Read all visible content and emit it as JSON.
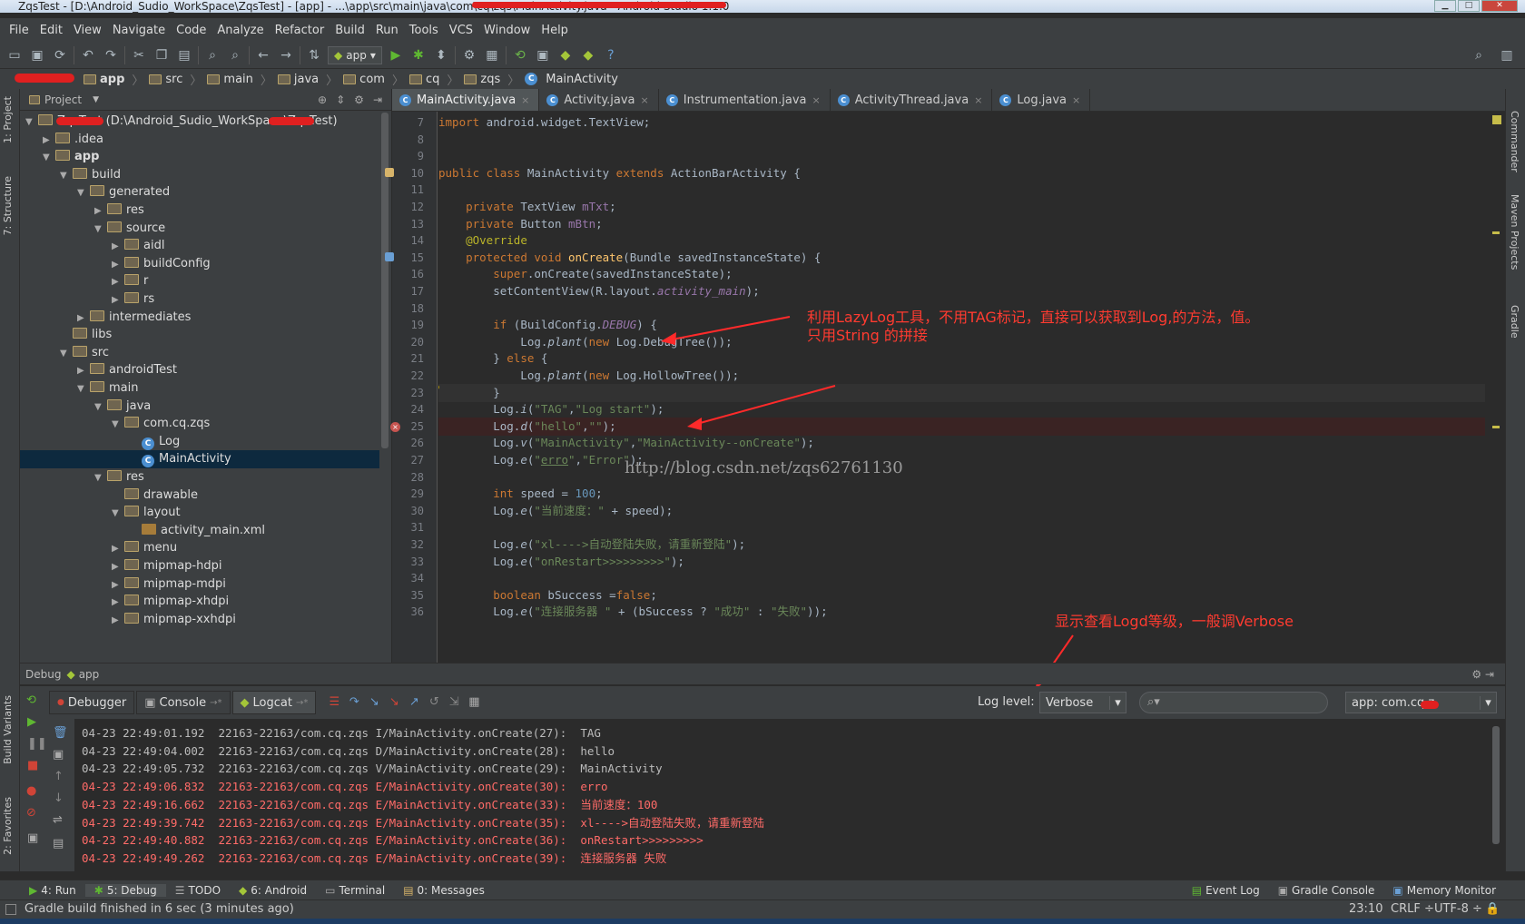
{
  "window": {
    "title": "ZqsTest - [D:\\Android_Sudio_WorkSpace\\ZqsTest] - [app] - ...\\app\\src\\main\\java\\com\\cq\\zqs\\MainActivity.java - Android Studio 1.1.0"
  },
  "menu": [
    "File",
    "Edit",
    "View",
    "Navigate",
    "Code",
    "Analyze",
    "Refactor",
    "Build",
    "Run",
    "Tools",
    "VCS",
    "Window",
    "Help"
  ],
  "toolbar": {
    "run_config": "app"
  },
  "breadcrumbs": [
    "app",
    "src",
    "main",
    "java",
    "com",
    "cq",
    "zqs",
    "MainActivity"
  ],
  "project_panel": {
    "title": "Project",
    "tree": [
      {
        "label": "ZqsTest (D:\\Android_Sudio_WorkSpace\\ZqsTest)",
        "depth": 0,
        "type": "root",
        "open": true
      },
      {
        "label": ".idea",
        "depth": 1,
        "type": "folder",
        "open": false
      },
      {
        "label": "app",
        "depth": 1,
        "type": "folder",
        "open": true,
        "bold": true
      },
      {
        "label": "build",
        "depth": 2,
        "type": "folder",
        "open": true
      },
      {
        "label": "generated",
        "depth": 3,
        "type": "folder",
        "open": true
      },
      {
        "label": "res",
        "depth": 4,
        "type": "folder",
        "open": false
      },
      {
        "label": "source",
        "depth": 4,
        "type": "folder",
        "open": true
      },
      {
        "label": "aidl",
        "depth": 5,
        "type": "folder",
        "open": false
      },
      {
        "label": "buildConfig",
        "depth": 5,
        "type": "folder",
        "open": false
      },
      {
        "label": "r",
        "depth": 5,
        "type": "folder",
        "open": false
      },
      {
        "label": "rs",
        "depth": 5,
        "type": "folder",
        "open": false
      },
      {
        "label": "intermediates",
        "depth": 3,
        "type": "folder",
        "open": false
      },
      {
        "label": "libs",
        "depth": 2,
        "type": "folder",
        "leaf": true
      },
      {
        "label": "src",
        "depth": 2,
        "type": "folder",
        "open": true
      },
      {
        "label": "androidTest",
        "depth": 3,
        "type": "folder",
        "open": false
      },
      {
        "label": "main",
        "depth": 3,
        "type": "folder",
        "open": true
      },
      {
        "label": "java",
        "depth": 4,
        "type": "folder",
        "open": true
      },
      {
        "label": "com.cq.zqs",
        "depth": 5,
        "type": "folder",
        "open": true
      },
      {
        "label": "Log",
        "depth": 6,
        "type": "class",
        "leaf": true
      },
      {
        "label": "MainActivity",
        "depth": 6,
        "type": "class",
        "leaf": true,
        "selected": true
      },
      {
        "label": "res",
        "depth": 4,
        "type": "folder",
        "open": true
      },
      {
        "label": "drawable",
        "depth": 5,
        "type": "folder",
        "leaf": true
      },
      {
        "label": "layout",
        "depth": 5,
        "type": "folder",
        "open": true
      },
      {
        "label": "activity_main.xml",
        "depth": 6,
        "type": "xml",
        "leaf": true
      },
      {
        "label": "menu",
        "depth": 5,
        "type": "folder",
        "open": false
      },
      {
        "label": "mipmap-hdpi",
        "depth": 5,
        "type": "folder",
        "open": false
      },
      {
        "label": "mipmap-mdpi",
        "depth": 5,
        "type": "folder",
        "open": false
      },
      {
        "label": "mipmap-xhdpi",
        "depth": 5,
        "type": "folder",
        "open": false
      },
      {
        "label": "mipmap-xxhdpi",
        "depth": 5,
        "type": "folder",
        "open": false
      }
    ]
  },
  "editor_tabs": [
    {
      "label": "MainActivity.java",
      "active": true
    },
    {
      "label": "Activity.java",
      "active": false
    },
    {
      "label": "Instrumentation.java",
      "active": false
    },
    {
      "label": "ActivityThread.java",
      "active": false
    },
    {
      "label": "Log.java",
      "active": false
    }
  ],
  "code_lines": [
    {
      "n": "7",
      "html": "<span class='kw'>import</span> android.widget.TextView;"
    },
    {
      "n": "8",
      "html": ""
    },
    {
      "n": "9",
      "html": ""
    },
    {
      "n": "10",
      "html": "<span class='kw'>public class</span> MainActivity <span class='kw'>extends</span> ActionBarActivity {"
    },
    {
      "n": "11",
      "html": ""
    },
    {
      "n": "12",
      "html": "    <span class='kw'>private</span> TextView <span class='fld'>mTxt</span>;"
    },
    {
      "n": "13",
      "html": "    <span class='kw'>private</span> Button <span class='fld'>mBtn</span>;"
    },
    {
      "n": "14",
      "html": "    <span class='ann'>@Override</span>"
    },
    {
      "n": "15",
      "html": "    <span class='kw'>protected void</span> <span class='mth'>onCreate</span>(Bundle savedInstanceState) {"
    },
    {
      "n": "16",
      "html": "        <span class='kw'>super</span>.onCreate(savedInstanceState);"
    },
    {
      "n": "17",
      "html": "        setContentView(R.layout.<span class='fld it'>activity_main</span>);"
    },
    {
      "n": "18",
      "html": ""
    },
    {
      "n": "19",
      "html": "        <span class='kw'>if</span> (BuildConfig.<span class='fld it'>DEBUG</span>) {"
    },
    {
      "n": "20",
      "html": "            Log.<span class='it'>plant</span>(<span class='kw'>new</span> Log.DebugTree());"
    },
    {
      "n": "21",
      "html": "        } <span class='kw'>else</span> {"
    },
    {
      "n": "22",
      "html": "            Log.<span class='it'>plant</span>(<span class='kw'>new</span> Log.HollowTree());"
    },
    {
      "n": "23",
      "html": "        }",
      "current": true
    },
    {
      "n": "24",
      "html": "        Log.<span class='it'>i</span>(<span class='str'>\"TAG\"</span>,<span class='str'>\"Log start\"</span>);"
    },
    {
      "n": "25",
      "html": "        Log.<span class='it'>d</span>(<span class='str'>\"hello\"</span>,<span class='str'>\"\"</span>);",
      "breakpoint": true
    },
    {
      "n": "26",
      "html": "        Log.<span class='it'>v</span>(<span class='str'>\"MainActivity\"</span>,<span class='str'>\"MainActivity--onCreate\"</span>);"
    },
    {
      "n": "27",
      "html": "        Log.<span class='it'>e</span>(<span class='str'>\"<span class='und'>erro</span>\"</span>,<span class='str'>\"Error\"</span>);"
    },
    {
      "n": "28",
      "html": ""
    },
    {
      "n": "29",
      "html": "        <span class='kw'>int</span> speed = <span class='num'>100</span>;"
    },
    {
      "n": "30",
      "html": "        Log.<span class='it'>e</span>(<span class='str'>\"当前速度：\"</span> + speed);"
    },
    {
      "n": "31",
      "html": ""
    },
    {
      "n": "32",
      "html": "        Log.<span class='it'>e</span>(<span class='str'>\"xl----&gt;自动登陆失败，请重新登陆\"</span>);"
    },
    {
      "n": "33",
      "html": "        Log.<span class='it'>e</span>(<span class='str'>\"onRestart&gt;&gt;&gt;&gt;&gt;&gt;&gt;&gt;&gt;\"</span>);"
    },
    {
      "n": "34",
      "html": ""
    },
    {
      "n": "35",
      "html": "        <span class='kw'>boolean</span> bSuccess =<span class='kw'>false</span>;"
    },
    {
      "n": "36",
      "html": "        Log.<span class='it'>e</span>(<span class='str'>\"连接服务器 \"</span> + (bSuccess ? <span class='str'>\"成功\"</span> : <span class='str'>\"失败\"</span>));"
    }
  ],
  "annotations": {
    "lazylog": "利用LazyLog工具，不用TAG标记，直接可以获取到Log,的方法，值。",
    "string_concat": "只用String 的拼接",
    "log_level": "显示查看Logd等级，一般调Verbose"
  },
  "watermark": "http://blog.csdn.net/zqs62761130",
  "debug_panel": {
    "title": "Debug",
    "config": "app",
    "tabs": [
      "Debugger",
      "Console",
      "Logcat"
    ],
    "log_level_label": "Log level:",
    "log_level_value": "Verbose",
    "search_placeholder": "",
    "process_filter": "app: com.cq.z"
  },
  "logcat": [
    {
      "text": "04-23 22:49:01.192  22163-22163/com.cq.zqs I/MainActivity.onCreate(27):  TAG",
      "level": "I"
    },
    {
      "text": "04-23 22:49:04.002  22163-22163/com.cq.zqs D/MainActivity.onCreate(28):  hello",
      "level": "D"
    },
    {
      "text": "04-23 22:49:05.732  22163-22163/com.cq.zqs V/MainActivity.onCreate(29):  MainActivity",
      "level": "V"
    },
    {
      "text": "04-23 22:49:06.832  22163-22163/com.cq.zqs E/MainActivity.onCreate(30):  erro",
      "level": "E"
    },
    {
      "text": "04-23 22:49:16.662  22163-22163/com.cq.zqs E/MainActivity.onCreate(33):  当前速度：100",
      "level": "E"
    },
    {
      "text": "04-23 22:49:39.742  22163-22163/com.cq.zqs E/MainActivity.onCreate(35):  xl---->自动登陆失败，请重新登陆",
      "level": "E"
    },
    {
      "text": "04-23 22:49:40.882  22163-22163/com.cq.zqs E/MainActivity.onCreate(36):  onRestart>>>>>>>>>",
      "level": "E"
    },
    {
      "text": "04-23 22:49:49.262  22163-22163/com.cq.zqs E/MainActivity.onCreate(39):  连接服务器 失败",
      "level": "E"
    }
  ],
  "bottom_tabs": {
    "run": "4: Run",
    "debug": "5: Debug",
    "todo": "TODO",
    "android": "6: Android",
    "terminal": "Terminal",
    "messages": "0: Messages",
    "event_log": "Event Log",
    "gradle_console": "Gradle Console",
    "memory_monitor": "Memory Monitor"
  },
  "side_tabs": {
    "project": "1: Project",
    "structure": "7: Structure",
    "build_variants": "Build Variants",
    "favorites": "2: Favorites",
    "commander": "Commander",
    "maven": "Maven Projects",
    "gradle": "Gradle"
  },
  "status": {
    "message": "Gradle build finished in 6 sec (3 minutes ago)",
    "position": "23:10",
    "line_sep": "CRLF ÷",
    "encoding": "UTF-8 ÷"
  },
  "colors": {
    "log_error": "#ff6b68",
    "log_normal": "#bbbbbb",
    "annotation": "#ff3b30"
  }
}
